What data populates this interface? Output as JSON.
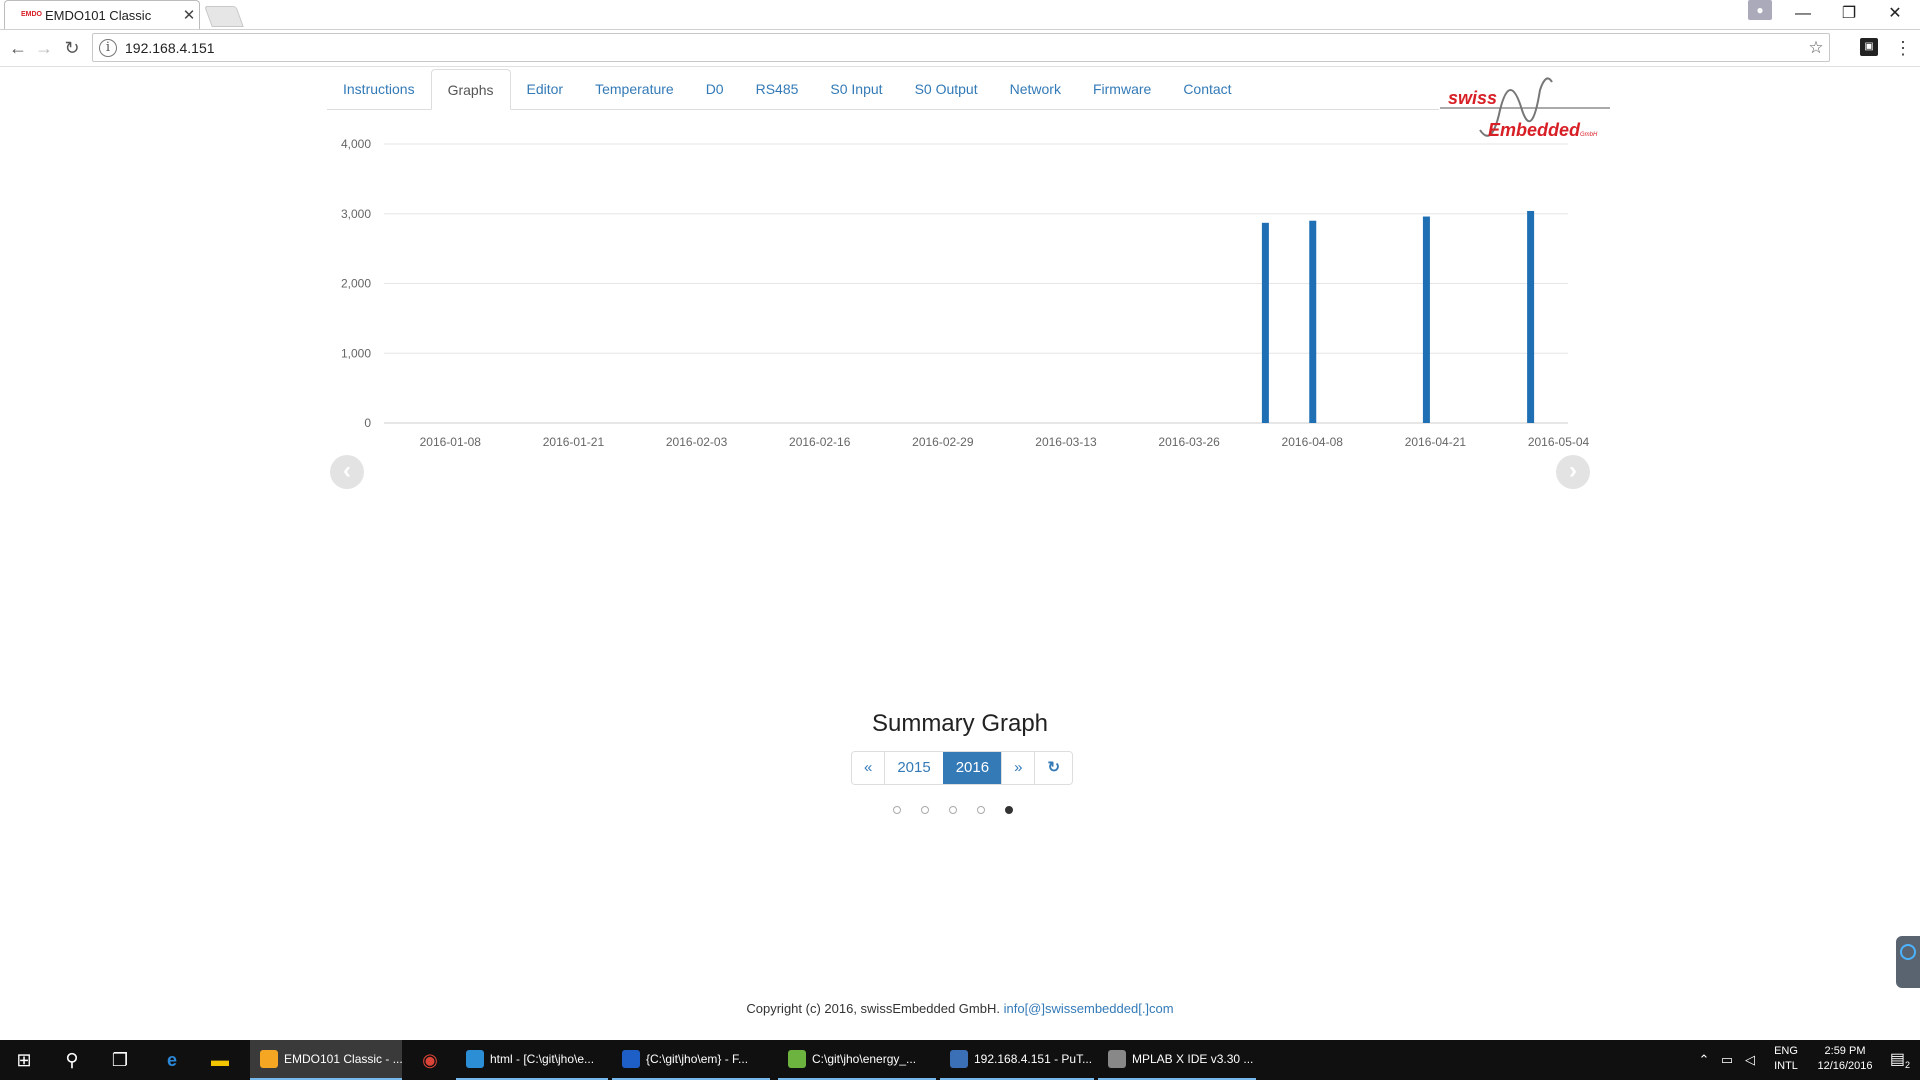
{
  "browser": {
    "tab_title": "EMDO101 Classic",
    "tab_close": "✕",
    "url": "192.168.4.151",
    "favicon_text": "EMDO"
  },
  "nav": {
    "tabs": [
      "Instructions",
      "Graphs",
      "Editor",
      "Temperature",
      "D0",
      "RS485",
      "S0 Input",
      "S0 Output",
      "Network",
      "Firmware",
      "Contact"
    ],
    "active": "Graphs"
  },
  "logo": {
    "line1": "swiss",
    "line2": "Embedded",
    "suffix": "GmbH"
  },
  "chart_data": {
    "type": "bar",
    "y_ticks": [
      "4,000",
      "3,000",
      "2,000",
      "1,000",
      "0"
    ],
    "ylim": [
      0,
      4000
    ],
    "x_tick_labels": [
      "2016-01-08",
      "2016-01-21",
      "2016-02-03",
      "2016-02-16",
      "2016-02-29",
      "2016-03-13",
      "2016-03-26",
      "2016-04-08",
      "2016-04-21",
      "2016-05-04"
    ],
    "x_start": "2016-01-01",
    "x_end": "2016-05-05",
    "bars": [
      {
        "x": "2016-04-03",
        "value": 2870
      },
      {
        "x": "2016-04-08",
        "value": 2900
      },
      {
        "x": "2016-04-20",
        "value": 2960
      },
      {
        "x": "2016-05-01",
        "value": 3040
      }
    ],
    "series_color": "#1f6fb4"
  },
  "carousel": {
    "prev": "‹",
    "next": "›",
    "dots": 5,
    "active_dot": 4
  },
  "summary": {
    "title": "Summary Graph",
    "prev": "«",
    "years": [
      "2015",
      "2016"
    ],
    "active_year": "2016",
    "next": "»",
    "refresh": "↻"
  },
  "footer": {
    "text": "Copyright (c) 2016, swissEmbedded GmbH.",
    "email": "info[@]swissembedded[.]com"
  },
  "taskbar": {
    "apps": [
      {
        "label": "EMDO101 Classic - ...",
        "color": "#f5a623"
      },
      {
        "label": "html - [C:\\git\\jho\\e...",
        "color": "#2c8fd6"
      },
      {
        "label": "{C:\\git\\jho\\em} - F...",
        "color": "#1e5fc7"
      },
      {
        "label": "C:\\git\\jho\\energy_...",
        "color": "#6db33f"
      },
      {
        "label": "192.168.4.151 - PuT...",
        "color": "#3b6fb6"
      },
      {
        "label": "MPLAB X IDE v3.30 ...",
        "color": "#888888"
      }
    ],
    "lang1": "ENG",
    "lang2": "INTL",
    "time": "2:59 PM",
    "date": "12/16/2016",
    "notif_count": "2"
  }
}
